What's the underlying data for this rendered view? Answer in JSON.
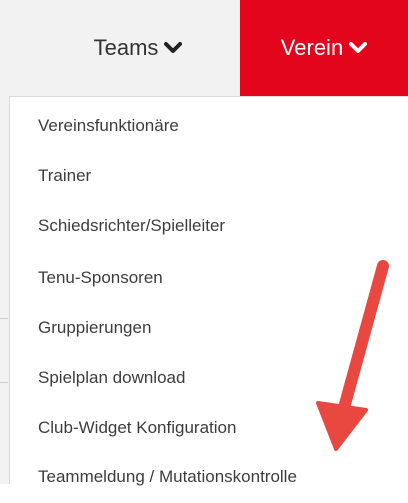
{
  "nav": {
    "teams_label": "Teams",
    "verein_label": "Verein",
    "teams_icon": "chevron-down-icon",
    "verein_icon": "chevron-down-icon",
    "verein_bg": "#e3051b"
  },
  "dropdown": {
    "items": [
      {
        "label": "Vereinsfunktionäre"
      },
      {
        "label": "Trainer"
      },
      {
        "label": "Schiedsrichter/Spielleiter"
      },
      {
        "label": "Tenu-Sponsoren"
      },
      {
        "label": "Gruppierungen"
      },
      {
        "label": "Spielplan download"
      },
      {
        "label": "Club-Widget Konfiguration"
      },
      {
        "label": "Teammeldung / Mutationskontrolle"
      }
    ]
  },
  "annotation": {
    "arrow_color": "#e8483f",
    "arrow_icon": "red-arrow-annotation"
  }
}
